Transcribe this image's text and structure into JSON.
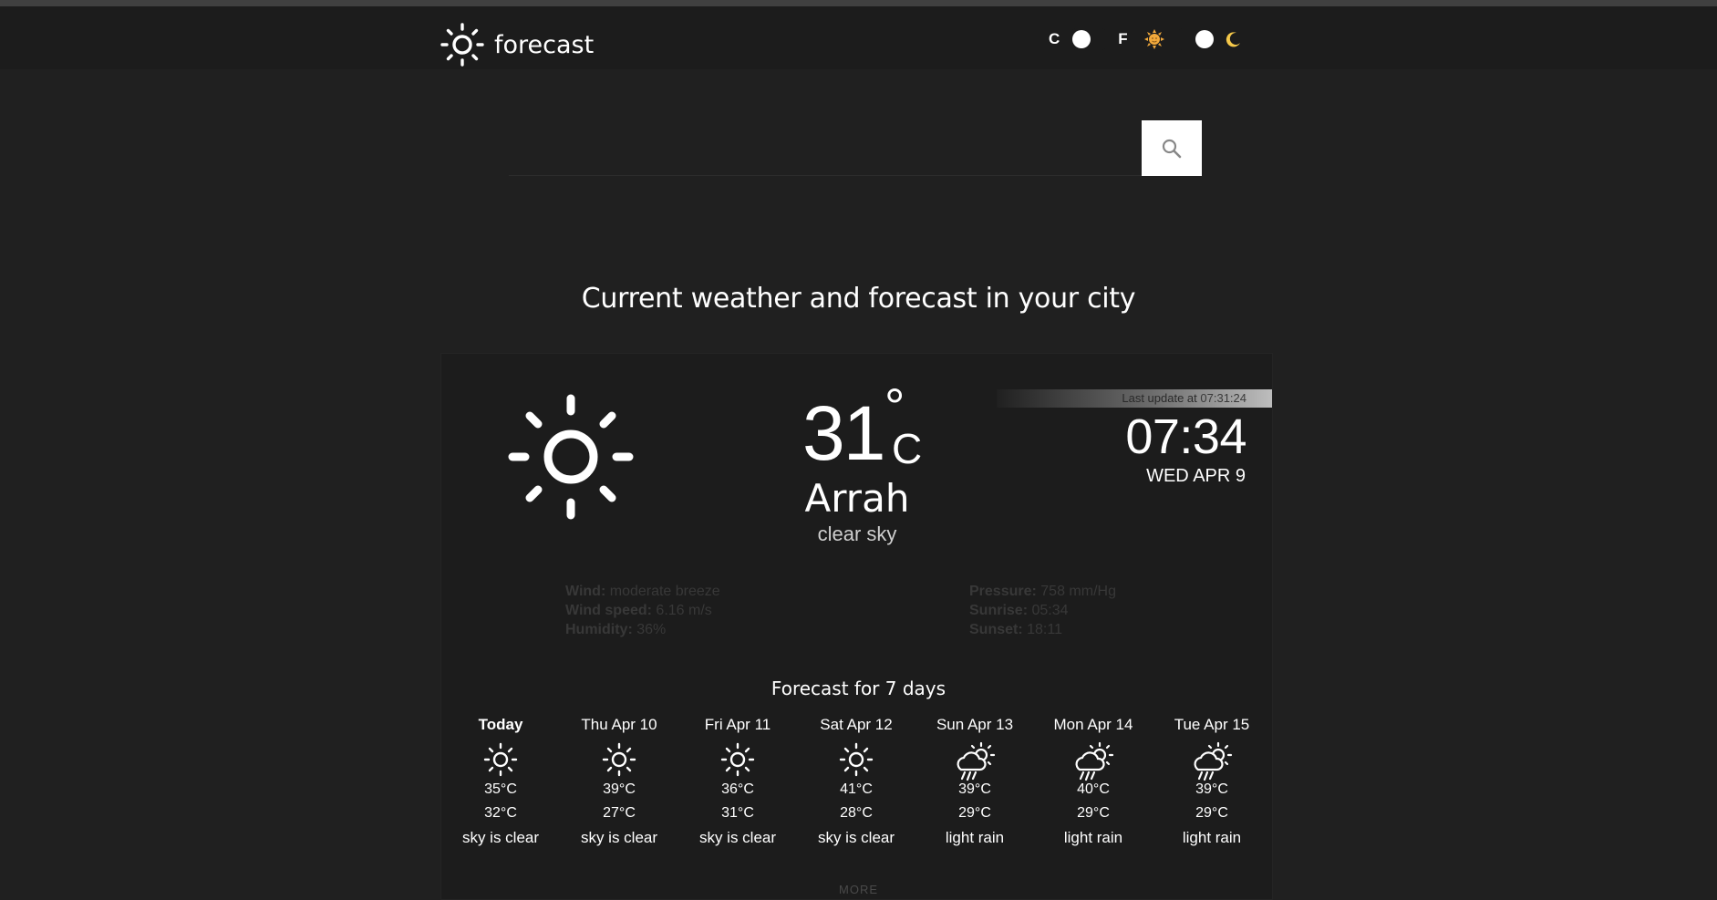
{
  "header": {
    "logo_text": "forecast",
    "unit_toggle": {
      "left_label": "C",
      "right_label": "F",
      "selected": "C"
    },
    "theme_toggle": {
      "selected": "dark"
    }
  },
  "search": {
    "value": "",
    "placeholder": ""
  },
  "headline": "Current weather and forecast in your city",
  "current": {
    "temp": "31",
    "deg": "°",
    "unit": "C",
    "city": "Arrah",
    "condition": "clear sky",
    "updated_label": "Last update at",
    "updated_time": "07:31:24",
    "time": "07:34",
    "date": "WED APR 9"
  },
  "details": {
    "left": [
      {
        "label": "Wind:",
        "value": "moderate breeze"
      },
      {
        "label": "Wind speed:",
        "value": "6.16 m/s"
      },
      {
        "label": "Humidity:",
        "value": "36%"
      }
    ],
    "right": [
      {
        "label": "Pressure:",
        "value": "758 mm/Hg"
      },
      {
        "label": "Sunrise:",
        "value": "05:34"
      },
      {
        "label": "Sunset:",
        "value": "18:11"
      }
    ]
  },
  "forecast": {
    "title": "Forecast for 7 days",
    "days": [
      {
        "name": "Today",
        "icon": "sun-icon",
        "max": "35°C",
        "min": "32°C",
        "desc": "sky is clear"
      },
      {
        "name": "Thu Apr 10",
        "icon": "sun-icon",
        "max": "39°C",
        "min": "27°C",
        "desc": "sky is clear"
      },
      {
        "name": "Fri Apr 11",
        "icon": "sun-icon",
        "max": "36°C",
        "min": "31°C",
        "desc": "sky is clear"
      },
      {
        "name": "Sat Apr 12",
        "icon": "sun-icon",
        "max": "41°C",
        "min": "28°C",
        "desc": "sky is clear"
      },
      {
        "name": "Sun Apr 13",
        "icon": "rain-cloud-sun-icon",
        "max": "39°C",
        "min": "29°C",
        "desc": "light rain"
      },
      {
        "name": "Mon Apr 14",
        "icon": "rain-cloud-sun-icon",
        "max": "40°C",
        "min": "29°C",
        "desc": "light rain"
      },
      {
        "name": "Tue Apr 15",
        "icon": "rain-cloud-sun-icon",
        "max": "39°C",
        "min": "29°C",
        "desc": "light rain"
      }
    ],
    "more_label": "MORE"
  }
}
